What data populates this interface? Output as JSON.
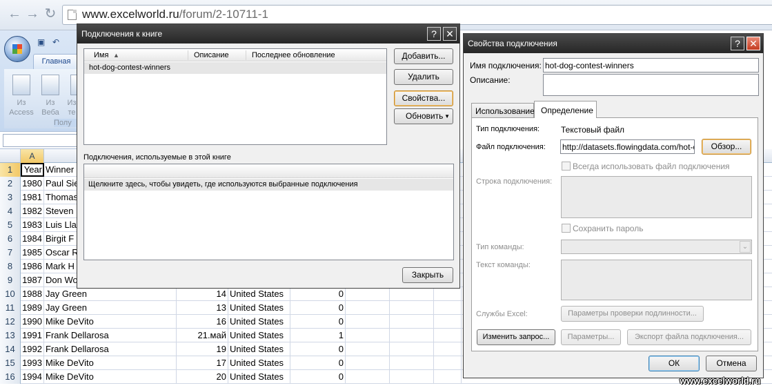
{
  "browser": {
    "url_host": "www.excelworld.ru",
    "url_path": "/forum/2-10711-1"
  },
  "ribbon": {
    "tab_home": "Главная",
    "buttons": [
      {
        "line1": "Из",
        "line2": "Access"
      },
      {
        "line1": "Из",
        "line2": "Веба"
      },
      {
        "line1": "Из",
        "line2": "те"
      }
    ],
    "group_label": "Полу"
  },
  "sheet": {
    "columns": [
      "A"
    ],
    "selected_column": "A",
    "rows": [
      {
        "n": "1",
        "a": "Year",
        "b": "Winner",
        "c": "",
        "d": "",
        "e": ""
      },
      {
        "n": "2",
        "a": "1980",
        "b": "Paul Sie",
        "c": "",
        "d": "",
        "e": ""
      },
      {
        "n": "3",
        "a": "1981",
        "b": "Thomas",
        "c": "",
        "d": "",
        "e": ""
      },
      {
        "n": "4",
        "a": "1982",
        "b": "Steven",
        "c": "",
        "d": "",
        "e": ""
      },
      {
        "n": "5",
        "a": "1983",
        "b": "Luis Lla",
        "c": "",
        "d": "",
        "e": ""
      },
      {
        "n": "6",
        "a": "1984",
        "b": "Birgit F",
        "c": "",
        "d": "",
        "e": ""
      },
      {
        "n": "7",
        "a": "1985",
        "b": "Oscar R",
        "c": "",
        "d": "",
        "e": ""
      },
      {
        "n": "8",
        "a": "1986",
        "b": "Mark H",
        "c": "",
        "d": "",
        "e": ""
      },
      {
        "n": "9",
        "a": "1987",
        "b": "Don Wo",
        "c": "",
        "d": "",
        "e": ""
      },
      {
        "n": "10",
        "a": "1988",
        "b": "Jay Green",
        "c": "14",
        "d": "United States",
        "e": "0"
      },
      {
        "n": "11",
        "a": "1989",
        "b": "Jay Green",
        "c": "13",
        "d": "United States",
        "e": "0"
      },
      {
        "n": "12",
        "a": "1990",
        "b": "Mike DeVito",
        "c": "16",
        "d": "United States",
        "e": "0"
      },
      {
        "n": "13",
        "a": "1991",
        "b": "Frank Dellarosa",
        "c": "21.май",
        "d": "United States",
        "e": "1"
      },
      {
        "n": "14",
        "a": "1992",
        "b": "Frank Dellarosa",
        "c": "19",
        "d": "United States",
        "e": "0"
      },
      {
        "n": "15",
        "a": "1993",
        "b": "Mike DeVito",
        "c": "17",
        "d": "United States",
        "e": "0"
      },
      {
        "n": "16",
        "a": "1994",
        "b": "Mike DeVito",
        "c": "20",
        "d": "United States",
        "e": "0"
      }
    ]
  },
  "connections_dialog": {
    "title": "Подключения к книге",
    "help": "?",
    "close": "✕",
    "col_name": "Имя",
    "col_desc": "Описание",
    "col_updated": "Последнее обновление",
    "connections": [
      {
        "name": "hot-dog-contest-winners"
      }
    ],
    "btn_add": "Добавить...",
    "btn_delete": "Удалить",
    "btn_properties": "Свойства...",
    "btn_refresh": "Обновить",
    "used_label": "Подключения, используемые в этой книге",
    "used_hint": "Щелкните здесь, чтобы увидеть, где используются выбранные подключения",
    "btn_close": "Закрыть"
  },
  "properties_dialog": {
    "title": "Свойства подключения",
    "help": "?",
    "close": "✕",
    "name_label": "Имя подключения:",
    "name_value": "hot-dog-contest-winners",
    "desc_label": "Описание:",
    "desc_value": "",
    "tab_usage": "Использование",
    "tab_definition": "Определение",
    "conn_type_label": "Тип подключения:",
    "conn_type_value": "Текстовый файл",
    "conn_file_label": "Файл подключения:",
    "conn_file_value": "http://datasets.flowingdata.com/hot-dog",
    "btn_browse": "Обзор...",
    "always_use_file": "Всегда использовать файл подключения",
    "conn_string_label": "Строка подключения:",
    "save_password": "Сохранить пароль",
    "command_type_label": "Тип команды:",
    "command_text_label": "Текст команды:",
    "excel_services_label": "Службы Excel:",
    "btn_auth": "Параметры проверки подлинности...",
    "btn_edit_query": "Изменить запрос...",
    "btn_params": "Параметры...",
    "btn_export": "Экспорт файла подключения...",
    "btn_ok": "ОК",
    "btn_cancel": "Отмена"
  },
  "watermark": "www.excelworld.ru",
  "colors": {
    "title_bar": "#262626",
    "selected_row": "#e6e6e6",
    "excel_header": "#dfe6ef"
  }
}
